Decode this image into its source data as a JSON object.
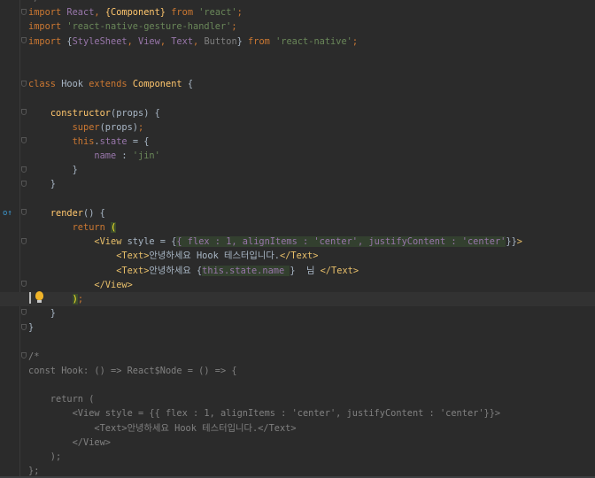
{
  "editor": {
    "lines": [
      {
        "t": [
          [
            "cm",
            "*/"
          ]
        ]
      },
      {
        "t": [
          [
            "kw",
            "import "
          ],
          [
            "pur",
            "React"
          ],
          [
            "kw",
            ", "
          ],
          [
            "fn",
            "{Component}"
          ],
          [
            "kw",
            " from "
          ],
          [
            "str",
            "'react'"
          ],
          [
            "kw",
            ";"
          ]
        ]
      },
      {
        "t": [
          [
            "kw",
            "import "
          ],
          [
            "str",
            "'react-native-gesture-handler'"
          ],
          [
            "kw",
            ";"
          ]
        ]
      },
      {
        "t": [
          [
            "kw",
            "import "
          ],
          [
            "def",
            "{"
          ],
          [
            "pur",
            "StyleSheet"
          ],
          [
            "kw",
            ", "
          ],
          [
            "pur",
            "View"
          ],
          [
            "kw",
            ", "
          ],
          [
            "pur",
            "Text"
          ],
          [
            "kw",
            ", "
          ],
          [
            "gray",
            "Button"
          ],
          [
            "def",
            "}"
          ],
          [
            "kw",
            " from "
          ],
          [
            "str",
            "'react-native'"
          ],
          [
            "kw",
            ";"
          ]
        ]
      },
      {
        "t": []
      },
      {
        "t": []
      },
      {
        "t": [
          [
            "kw",
            "class "
          ],
          [
            "def",
            "Hook "
          ],
          [
            "kw",
            "extends "
          ],
          [
            "fn",
            "Component "
          ],
          [
            "def",
            "{"
          ]
        ]
      },
      {
        "t": []
      },
      {
        "t": [
          [
            "def",
            "    "
          ],
          [
            "fn",
            "constructor"
          ],
          [
            "def",
            "(props) {"
          ]
        ]
      },
      {
        "t": [
          [
            "def",
            "        "
          ],
          [
            "kw",
            "super"
          ],
          [
            "def",
            "(props)"
          ],
          [
            "kw",
            ";"
          ]
        ]
      },
      {
        "t": [
          [
            "def",
            "        "
          ],
          [
            "kw",
            "this"
          ],
          [
            "def",
            "."
          ],
          [
            "pur",
            "state"
          ],
          [
            "def",
            " = {"
          ]
        ]
      },
      {
        "t": [
          [
            "def",
            "            "
          ],
          [
            "pur",
            "name"
          ],
          [
            "def",
            " : "
          ],
          [
            "str",
            "'jin'"
          ]
        ]
      },
      {
        "t": [
          [
            "def",
            "        }"
          ]
        ]
      },
      {
        "t": [
          [
            "def",
            "    }"
          ]
        ]
      },
      {
        "t": []
      },
      {
        "t": [
          [
            "def",
            "    "
          ],
          [
            "fn",
            "render"
          ],
          [
            "def",
            "() {"
          ]
        ]
      },
      {
        "t": [
          [
            "def",
            "        "
          ],
          [
            "kw",
            "return "
          ],
          [
            "paren",
            "("
          ]
        ]
      },
      {
        "t": [
          [
            "def",
            "            "
          ],
          [
            "tag",
            "<View "
          ],
          [
            "def",
            "style = {"
          ],
          [
            "hl",
            "{ flex : 1, alignItems : 'center', justifyContent : 'center'"
          ],
          [
            "def",
            "}}"
          ],
          [
            "tag",
            ">"
          ]
        ]
      },
      {
        "t": [
          [
            "def",
            "                "
          ],
          [
            "tag",
            "<Text>"
          ],
          [
            "def",
            "안녕하세요 Hook 테스터입니다."
          ],
          [
            "tag",
            "</Text>"
          ]
        ]
      },
      {
        "t": [
          [
            "def",
            "                "
          ],
          [
            "tag",
            "<Text>"
          ],
          [
            "def",
            "안녕하세요 {"
          ],
          [
            "hlv",
            "this.state.name "
          ],
          [
            "def",
            "}  님 "
          ],
          [
            "tag",
            "</Text>"
          ]
        ]
      },
      {
        "t": [
          [
            "def",
            "            "
          ],
          [
            "tag",
            "</View>"
          ]
        ]
      },
      {
        "current": true,
        "t": [
          [
            "def",
            "        "
          ],
          [
            "paren",
            ")"
          ],
          [
            "kw",
            ";"
          ]
        ]
      },
      {
        "t": [
          [
            "def",
            "    }"
          ]
        ]
      },
      {
        "t": [
          [
            "def",
            "}"
          ]
        ]
      },
      {
        "t": []
      },
      {
        "t": [
          [
            "cm",
            "/*"
          ]
        ]
      },
      {
        "t": [
          [
            "cm",
            "const Hook: () => React$Node = () => {"
          ]
        ]
      },
      {
        "t": []
      },
      {
        "t": [
          [
            "cm",
            "    return ("
          ]
        ]
      },
      {
        "t": [
          [
            "cm",
            "        <View style = {{ flex : 1, alignItems : 'center', justifyContent : 'center'}}>"
          ]
        ]
      },
      {
        "t": [
          [
            "cm",
            "            <Text>안녕하세요 Hook 테스터입니다.</Text>"
          ]
        ]
      },
      {
        "t": [
          [
            "cm",
            "        </View>"
          ]
        ]
      },
      {
        "t": [
          [
            "cm",
            "    );"
          ]
        ]
      },
      {
        "t": [
          [
            "cm",
            "};"
          ]
        ]
      }
    ]
  },
  "gutter": {
    "override_marker": "o↑"
  }
}
